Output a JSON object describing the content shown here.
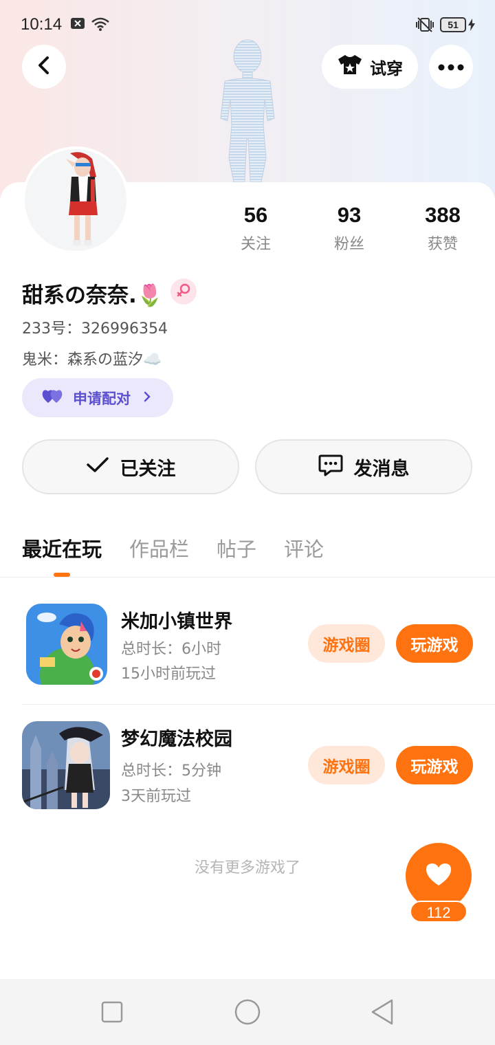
{
  "status_bar": {
    "time": "10:14",
    "battery": "51"
  },
  "header": {
    "try_on_label": "试穿"
  },
  "profile": {
    "stats": [
      {
        "value": "56",
        "label": "关注"
      },
      {
        "value": "93",
        "label": "粉丝"
      },
      {
        "value": "388",
        "label": "获赞"
      }
    ],
    "nickname": "甜系の奈奈.🌷",
    "id_line": "233号：326996354",
    "ghost_line": "鬼米：森系の蓝汐☁️",
    "pair_label": "申请配对",
    "follow_label": "已关注",
    "message_label": "发消息"
  },
  "tabs": [
    {
      "label": "最近在玩",
      "active": true
    },
    {
      "label": "作品栏",
      "active": false
    },
    {
      "label": "帖子",
      "active": false
    },
    {
      "label": "评论",
      "active": false
    }
  ],
  "games": [
    {
      "title": "米加小镇世界",
      "duration": "总时长：6小时",
      "last_played": "15小时前玩过",
      "circle_label": "游戏圈",
      "play_label": "玩游戏"
    },
    {
      "title": "梦幻魔法校园",
      "duration": "总时长：5分钟",
      "last_played": "3天前玩过",
      "circle_label": "游戏圈",
      "play_label": "玩游戏"
    }
  ],
  "footer_note": "没有更多游戏了",
  "like": {
    "count": "112"
  },
  "colors": {
    "accent": "#ff7210",
    "accent_light": "#ffe8d9",
    "pair_bg": "#ebe8fb",
    "pair_text": "#5a4fcf"
  },
  "icons": {
    "back": "chevron-left-icon",
    "try_on": "tshirt-icon",
    "more": "more-dots-icon",
    "gender": "female-icon",
    "pair": "hearts-icon",
    "follow": "check-icon",
    "message": "chat-icon",
    "like": "heart-icon"
  }
}
